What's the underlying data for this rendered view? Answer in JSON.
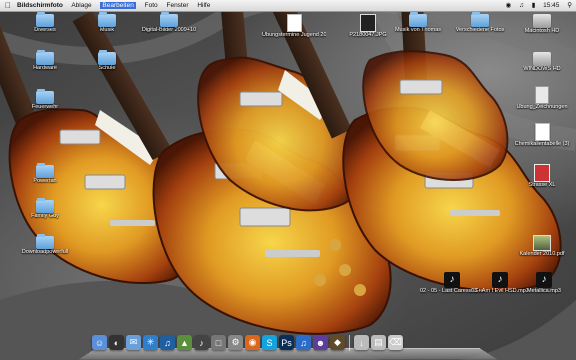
{
  "menubar": {
    "apple_icon": "apple-icon",
    "app_name": "Bildschirmfoto",
    "menus": [
      "Ablage",
      "Bearbeiten",
      "Foto",
      "Fenster",
      "Hilfe"
    ],
    "active_menu": "Bearbeiten",
    "clock": "15:45",
    "status_icons": [
      "wifi-icon",
      "volume-icon",
      "battery-icon",
      "spotlight-icon"
    ]
  },
  "desktop_icons": [
    {
      "label": "Diverses",
      "icon": "folder-icon"
    },
    {
      "label": "Hardware",
      "icon": "folder-icon"
    },
    {
      "label": "Musik",
      "icon": "folder-icon"
    },
    {
      "label": "Schule",
      "icon": "folder-icon"
    },
    {
      "label": "Feuerwehr",
      "icon": "folder-icon"
    },
    {
      "label": "Powerfan",
      "icon": "folder-icon"
    },
    {
      "label": "Family Guy",
      "icon": "folder-icon"
    },
    {
      "label": "Downloadpowerfull",
      "icon": "folder-icon"
    },
    {
      "label": "Digital-Bilder 2009+10",
      "icon": "folder-icon"
    },
    {
      "label": "Übungstermine Jugend 2010.xls",
      "icon": "document-icon"
    },
    {
      "label": "P2180047.JPG",
      "icon": "image-icon"
    },
    {
      "label": "Musik von Thomas",
      "icon": "folder-icon"
    },
    {
      "label": "Verschiedene Fotos",
      "icon": "folder-icon"
    },
    {
      "label": "Macintosh HD",
      "icon": "drive-icon"
    },
    {
      "label": "WINDOWS HD",
      "icon": "drive-icon"
    },
    {
      "label": "Übung_Zeichnungen",
      "icon": "document-icon"
    },
    {
      "label": "Chemikalientabelle (3)",
      "icon": "document-icon"
    },
    {
      "label": "Strasse XL",
      "icon": "document-icon"
    },
    {
      "label": "Kalender 2010.pdf",
      "icon": "pdf-icon"
    },
    {
      "label": "02 - 05 - Last Caress/ Green H...MP3.mp3",
      "icon": "music-icon"
    },
    {
      "label": "03 - Am I Evil HSD.mp3",
      "icon": "music-icon"
    },
    {
      "label": "Metallica.mp3",
      "icon": "music-icon"
    }
  ],
  "dock": {
    "items": [
      "finder-icon",
      "dashboard-icon",
      "mail-icon",
      "safari-icon",
      "itunes-icon",
      "iphoto-icon",
      "garageband-icon",
      "preview-icon",
      "system-preferences-icon",
      "firefox-icon",
      "skype-icon",
      "photoshop-icon",
      "itunes-store-icon",
      "adium-icon",
      "other-icon"
    ],
    "stack_items": [
      "downloads-stack-icon",
      "documents-stack-icon",
      "trash-icon"
    ]
  },
  "wallpaper": "wallpaper-les-paul-guitars",
  "colors": {
    "menubar_highlight": "#3a6fd8",
    "folder": "#7fb6e6"
  }
}
